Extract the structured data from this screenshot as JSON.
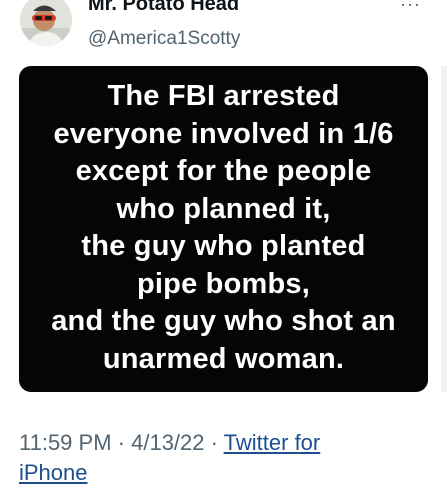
{
  "author": {
    "display_name": "Mr. Potato Head",
    "handle": "@America1Scotty"
  },
  "more_label": "···",
  "image_text_lines": [
    "The FBI arrested",
    "everyone involved in 1/6",
    "except for the people",
    "who planned it,",
    "the guy who planted",
    "pipe bombs,",
    "and the guy who shot an",
    "unarmed woman."
  ],
  "meta": {
    "time": "11:59 PM",
    "separator": " · ",
    "date": "4/13/22",
    "source_prefix": "Twitter for",
    "source_suffix": "iPhone"
  },
  "icons": {
    "avatar": "profile-photo",
    "more": "more-dots-icon"
  }
}
